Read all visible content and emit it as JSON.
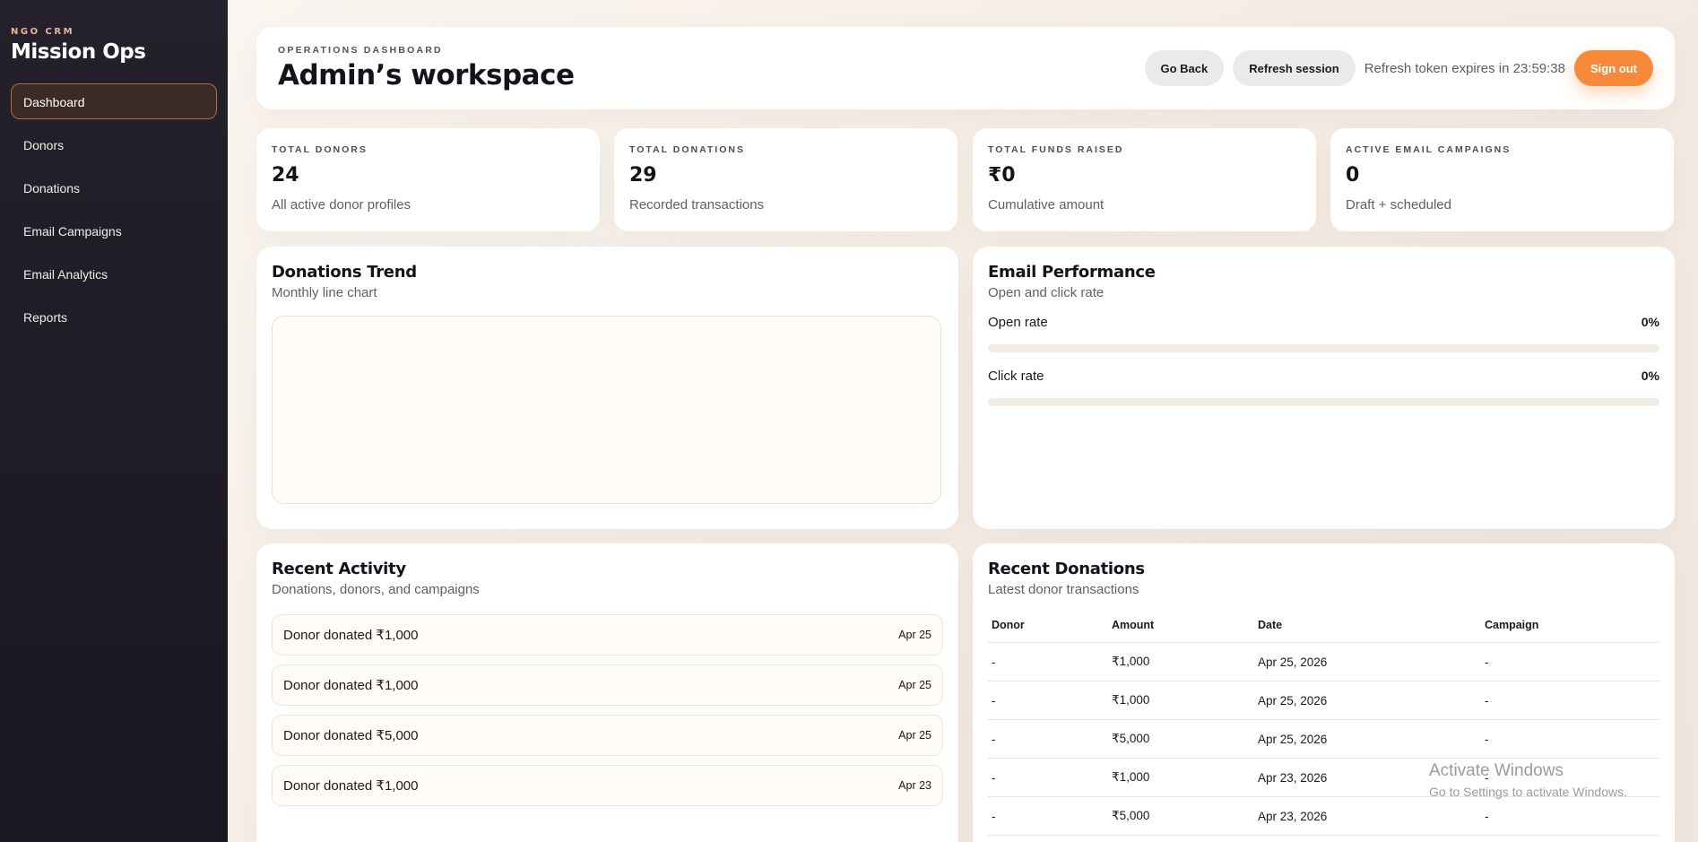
{
  "sidebar": {
    "kicker": "NGO CRM",
    "title": "Mission Ops",
    "items": [
      {
        "label": "Dashboard",
        "active": true
      },
      {
        "label": "Donors"
      },
      {
        "label": "Donations"
      },
      {
        "label": "Email Campaigns"
      },
      {
        "label": "Email Analytics"
      },
      {
        "label": "Reports"
      }
    ]
  },
  "header": {
    "kicker": "OPERATIONS DASHBOARD",
    "title": "Admin’s workspace",
    "go_back": "Go Back",
    "refresh": "Refresh session",
    "token_text": "Refresh token expires in 23:59:38",
    "sign_out": "Sign out"
  },
  "stats": [
    {
      "label": "TOTAL DONORS",
      "value": "24",
      "sub": "All active donor profiles"
    },
    {
      "label": "TOTAL DONATIONS",
      "value": "29",
      "sub": "Recorded transactions"
    },
    {
      "label": "TOTAL FUNDS RAISED",
      "value": "₹0",
      "sub": "Cumulative amount"
    },
    {
      "label": "ACTIVE EMAIL CAMPAIGNS",
      "value": "0",
      "sub": "Draft + scheduled"
    }
  ],
  "trend": {
    "title": "Donations Trend",
    "sub": "Monthly line chart"
  },
  "email": {
    "title": "Email Performance",
    "sub": "Open and click rate",
    "open_label": "Open rate",
    "open_value": "0%",
    "open_fraction": 0,
    "click_label": "Click rate",
    "click_value": "0%",
    "click_fraction": 0
  },
  "activity": {
    "title": "Recent Activity",
    "sub": "Donations, donors, and campaigns",
    "items": [
      {
        "text": "Donor donated ₹1,000",
        "date": "Apr 25"
      },
      {
        "text": "Donor donated ₹1,000",
        "date": "Apr 25"
      },
      {
        "text": "Donor donated ₹5,000",
        "date": "Apr 25"
      },
      {
        "text": "Donor donated ₹1,000",
        "date": "Apr 23"
      }
    ]
  },
  "donations": {
    "title": "Recent Donations",
    "sub": "Latest donor transactions",
    "columns": [
      "Donor",
      "Amount",
      "Date",
      "Campaign"
    ],
    "rows": [
      [
        "-",
        "₹1,000",
        "Apr 25, 2026",
        "-"
      ],
      [
        "-",
        "₹1,000",
        "Apr 25, 2026",
        "-"
      ],
      [
        "-",
        "₹5,000",
        "Apr 25, 2026",
        "-"
      ],
      [
        "-",
        "₹1,000",
        "Apr 23, 2026",
        "-"
      ],
      [
        "-",
        "₹5,000",
        "Apr 23, 2026",
        "-"
      ]
    ]
  },
  "watermark": {
    "title": "Activate Windows",
    "sub": "Go to Settings to activate Windows."
  },
  "colors": {
    "accent": "#f68a3a",
    "sidebar": "#1f1c26"
  }
}
